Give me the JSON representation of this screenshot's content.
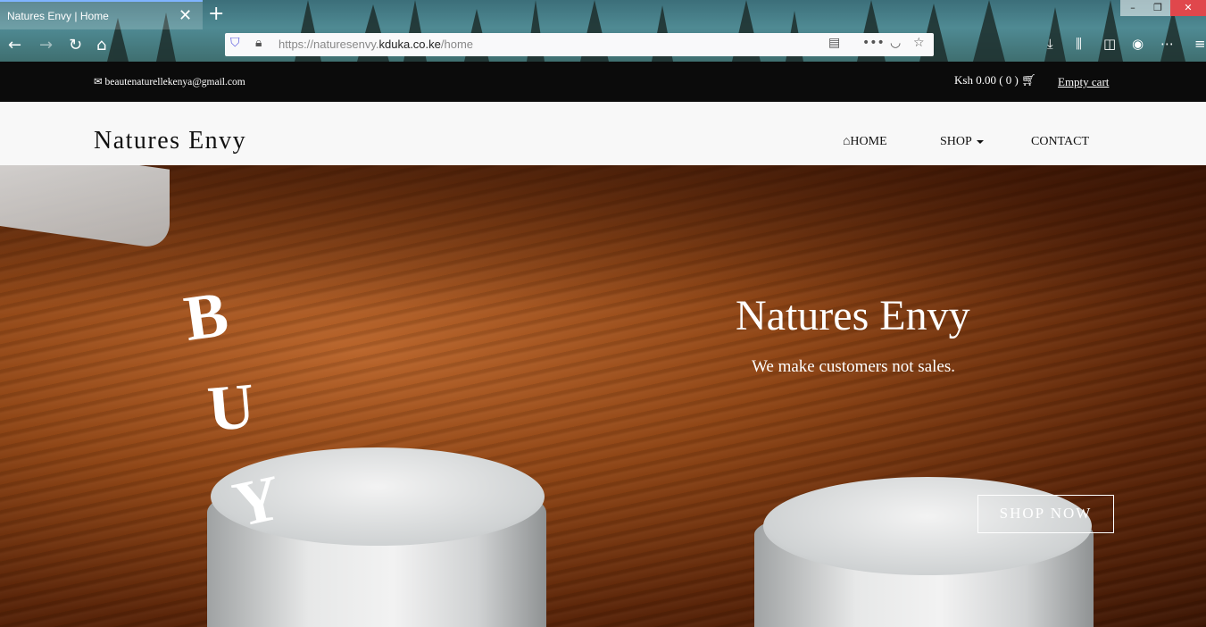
{
  "browser": {
    "tab_title": "Natures Envy | Home",
    "tab_close": "✕",
    "new_tab": "+",
    "url_prefix": "https://naturesenvy.",
    "url_domain": "kduka.co.ke",
    "url_path": "/home",
    "icons": [
      "back-arrow-icon",
      "forward-arrow-icon",
      "reload-icon",
      "home-icon",
      "shield-icon",
      "lock-icon",
      "reader-icon",
      "more-icon",
      "pocket-icon",
      "star-icon",
      "download-icon",
      "library-icon",
      "sidebar-icon",
      "account-icon",
      "extensions-icon",
      "menu-icon"
    ]
  },
  "topbar": {
    "email": "beautenaturellekenya@gmail.com",
    "cart_total": "Ksh 0.00 ( 0 )",
    "empty_cart": "Empty cart"
  },
  "navbar": {
    "brand": "Natures Envy",
    "home": "HOME",
    "shop": "SHOP",
    "contact": "CONTACT"
  },
  "hero": {
    "letters": [
      "B",
      "U",
      "Y"
    ],
    "title": "Natures Envy",
    "subtitle": "We make customers not sales.",
    "cta": "SHOP NOW"
  },
  "colors": {
    "topbar_bg": "#0b0b0b",
    "navbar_bg": "#f8f8f8",
    "hero_wood": "#8f4515"
  }
}
